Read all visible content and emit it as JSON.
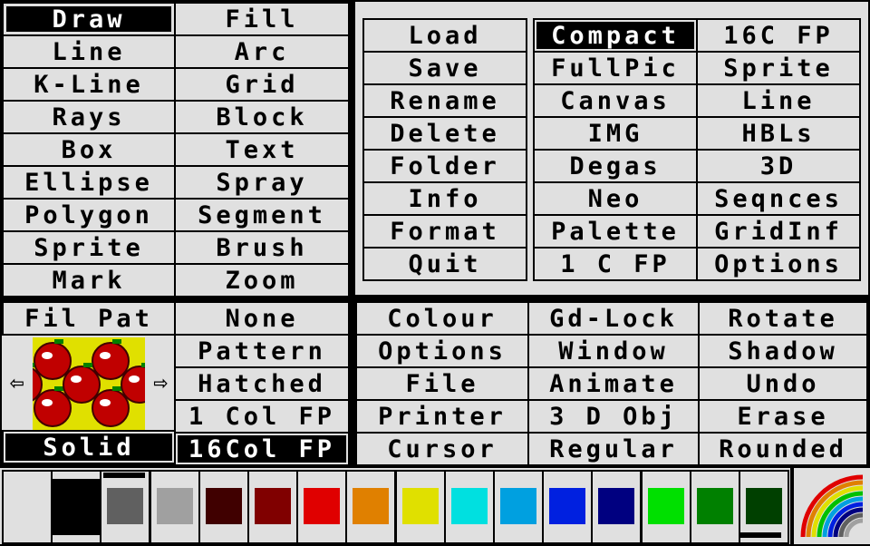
{
  "tools_left": [
    "Draw",
    "Line",
    "K-Line",
    "Rays",
    "Box",
    "Ellipse",
    "Polygon",
    "Sprite",
    "Mark"
  ],
  "tools_right": [
    "Fill",
    "Arc",
    "Grid",
    "Block",
    "Text",
    "Spray",
    "Segment",
    "Brush",
    "Zoom"
  ],
  "file_menu": [
    "Load",
    "Save",
    "Rename",
    "Delete",
    "Folder",
    "Info",
    "Format",
    "Quit"
  ],
  "format_col1": [
    "Compact",
    "FullPic",
    "Canvas",
    "IMG",
    "Degas",
    "Neo",
    "Palette",
    "1 C FP"
  ],
  "format_col2": [
    "16C FP",
    "Sprite",
    "Line",
    "HBLs",
    "3D",
    "Seqnces",
    "GridInf",
    "Options"
  ],
  "fill": {
    "header": "Fil Pat",
    "left_arrow": "⇦",
    "right_arrow": "⇨",
    "solid": "Solid",
    "options": [
      "None",
      "Pattern",
      "Hatched",
      "1 Col FP",
      "16Col FP"
    ]
  },
  "settings": {
    "col1": [
      "Colour",
      "Options",
      "File",
      "Printer",
      "Cursor"
    ],
    "col2": [
      "Gd-Lock",
      "Window",
      "Animate",
      "3 D Obj",
      "Regular"
    ],
    "col3": [
      "Rotate",
      "Shadow",
      "Undo",
      "Erase",
      "Rounded"
    ]
  },
  "palette_colors": [
    "#e0e0e0",
    "#000000",
    "#606060",
    "#a0a0a0",
    "#400000",
    "#800000",
    "#e00000",
    "#e08000",
    "#e0e000",
    "#00e0e0",
    "#00a0e0",
    "#0020e0",
    "#000080",
    "#00e000",
    "#008000",
    "#004000"
  ],
  "pattern_colors": {
    "bg": "#e0e000",
    "fruit": "#c00000",
    "highlight": "#ffffff",
    "leaf": "#008000"
  },
  "rainbow_colors": [
    "#e00000",
    "#e08000",
    "#e0e000",
    "#00c000",
    "#00a0e0",
    "#0020e0",
    "#000080",
    "#606060",
    "#a0a0a0"
  ]
}
